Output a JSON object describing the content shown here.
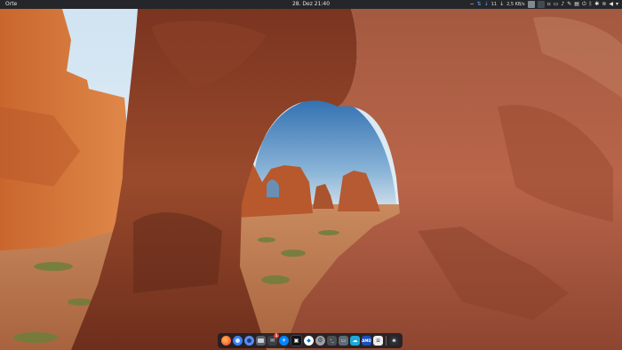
{
  "top_panel": {
    "activities_label": "Orte",
    "clock": "28. Dez  21:40",
    "tray": {
      "indicator_number": "11",
      "network_speed": "2,5 KB/s"
    }
  },
  "dock": {
    "apps": [
      {
        "name": "firefox-app-icon",
        "color": "#ff7139"
      },
      {
        "name": "chromium-app-icon",
        "color": "#3b82f6"
      },
      {
        "name": "browser-app-icon",
        "color": "#5b8def"
      },
      {
        "name": "files-app-icon",
        "color": "#59606a"
      },
      {
        "name": "mail-app-icon",
        "color": "#3a3f47",
        "badge": "1"
      },
      {
        "name": "messenger-app-icon",
        "color": "#0084ff"
      },
      {
        "name": "ide-app-icon",
        "color": "#111418"
      },
      {
        "name": "vscode-app-icon",
        "color": "#ffffff"
      },
      {
        "name": "settings-app-icon",
        "color": "#9aa0a6"
      },
      {
        "name": "terminal-app-icon",
        "color": "#4a4f55"
      },
      {
        "name": "monitor-app-icon",
        "color": "#5f6a75"
      },
      {
        "name": "cloud-app-icon",
        "color": "#1fa8d8"
      },
      {
        "name": "amd-app-icon",
        "color": "#1a4fbf"
      },
      {
        "name": "notes-app-icon",
        "color": "#eeeeee"
      },
      {
        "name": "app-grid-icon",
        "color": "#2b2f36"
      }
    ]
  }
}
